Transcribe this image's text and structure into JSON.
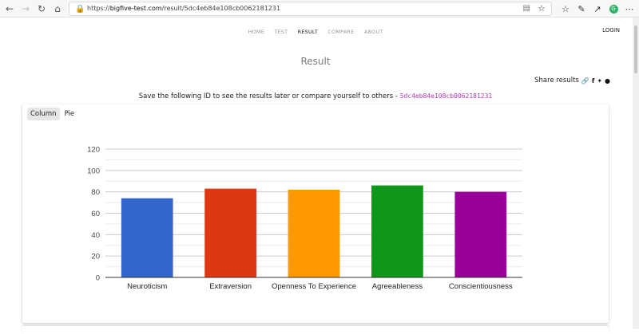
{
  "browser": {
    "url_prefix": "https://",
    "url_host": "bigfive-test.com",
    "url_path": "/result/5dc4eb84e108cb0062181231"
  },
  "nav": {
    "items": [
      "HOME",
      "TEST",
      "RESULT",
      "COMPARE",
      "ABOUT"
    ],
    "active": "RESULT",
    "login": "LOGIN"
  },
  "page": {
    "title": "Result",
    "share_label": "Share results",
    "save_text": "Save the following ID to see the results later or compare yourself to others - ",
    "result_id": "5dc4eb84e108cb0062181231"
  },
  "tabs": [
    "Column",
    "Pie"
  ],
  "colors": {
    "neuroticism": "#3366cc",
    "extraversion": "#dc3912",
    "openness": "#ff9900",
    "agreeableness": "#109618",
    "conscientiousness": "#990099"
  },
  "chart_data": {
    "type": "bar",
    "categories": [
      "Neuroticism",
      "Extraversion",
      "Openness To Experience",
      "Agreeableness",
      "Conscientiousness"
    ],
    "values": [
      74,
      83,
      82,
      86,
      80
    ],
    "colors": [
      "#3366cc",
      "#dc3912",
      "#ff9900",
      "#109618",
      "#990099"
    ],
    "ylim": [
      0,
      120
    ],
    "yticks": [
      0,
      20,
      40,
      60,
      80,
      100,
      120
    ],
    "grid": true
  }
}
